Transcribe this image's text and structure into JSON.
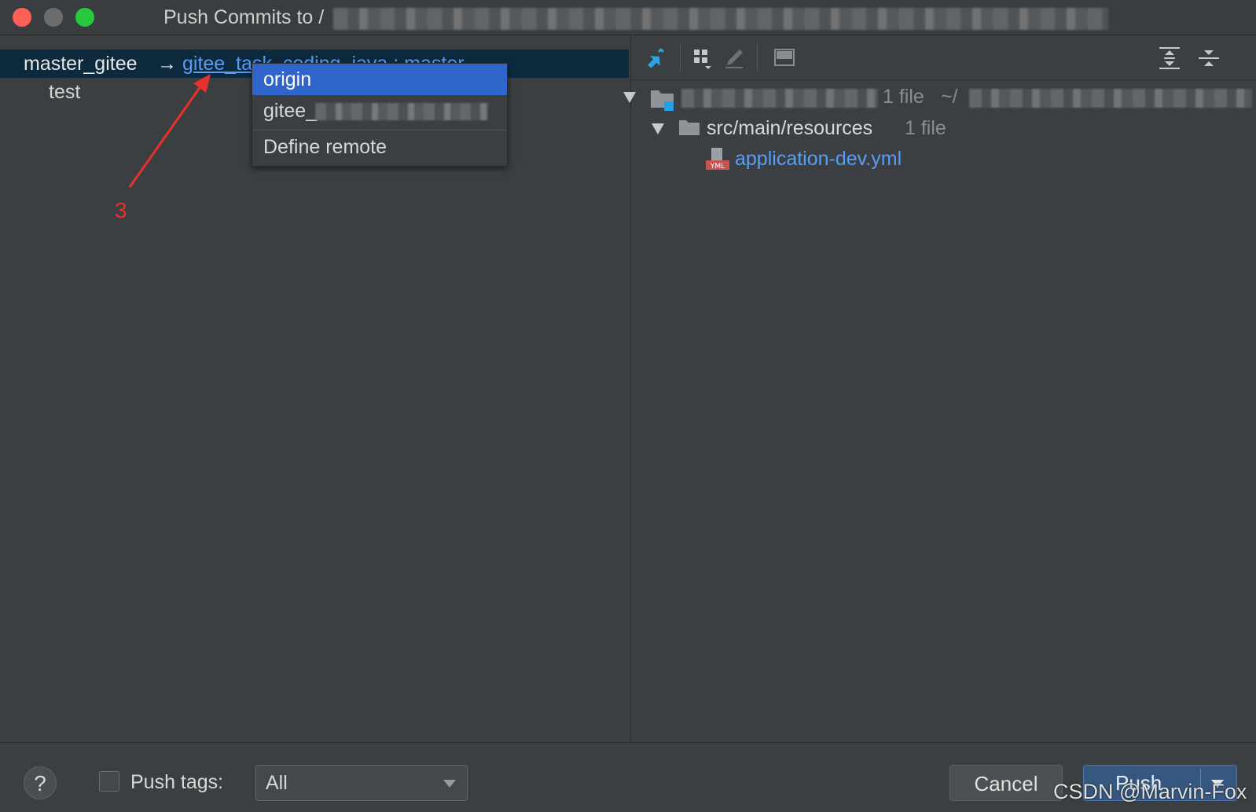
{
  "window": {
    "title": "Push Commits to /"
  },
  "left_pane": {
    "local_branch": "master_gitee",
    "arrow": "→",
    "remote_branch": "gitee_task_coding_java : master",
    "commits": [
      "test"
    ]
  },
  "remote_popup": {
    "items": [
      "origin",
      "gitee_",
      "Define remote"
    ],
    "selected": "origin"
  },
  "annotation": {
    "label": "3",
    "color": "#e8302c"
  },
  "right_pane": {
    "repo": {
      "count": "1 file",
      "path_prefix": "~/"
    },
    "folder": {
      "name": "src/main/resources",
      "count": "1 file"
    },
    "file": {
      "name": "application-dev.yml",
      "icon": "yml-file-icon"
    }
  },
  "footer": {
    "help_label": "?",
    "push_tags_label": "Push tags:",
    "push_tags_value": "All",
    "cancel_label": "Cancel",
    "push_label": "Push"
  },
  "watermark": "CSDN @Marvin-Fox",
  "colors": {
    "selection": "#2f65ca",
    "link": "#589df6",
    "background": "#3c3f41"
  }
}
